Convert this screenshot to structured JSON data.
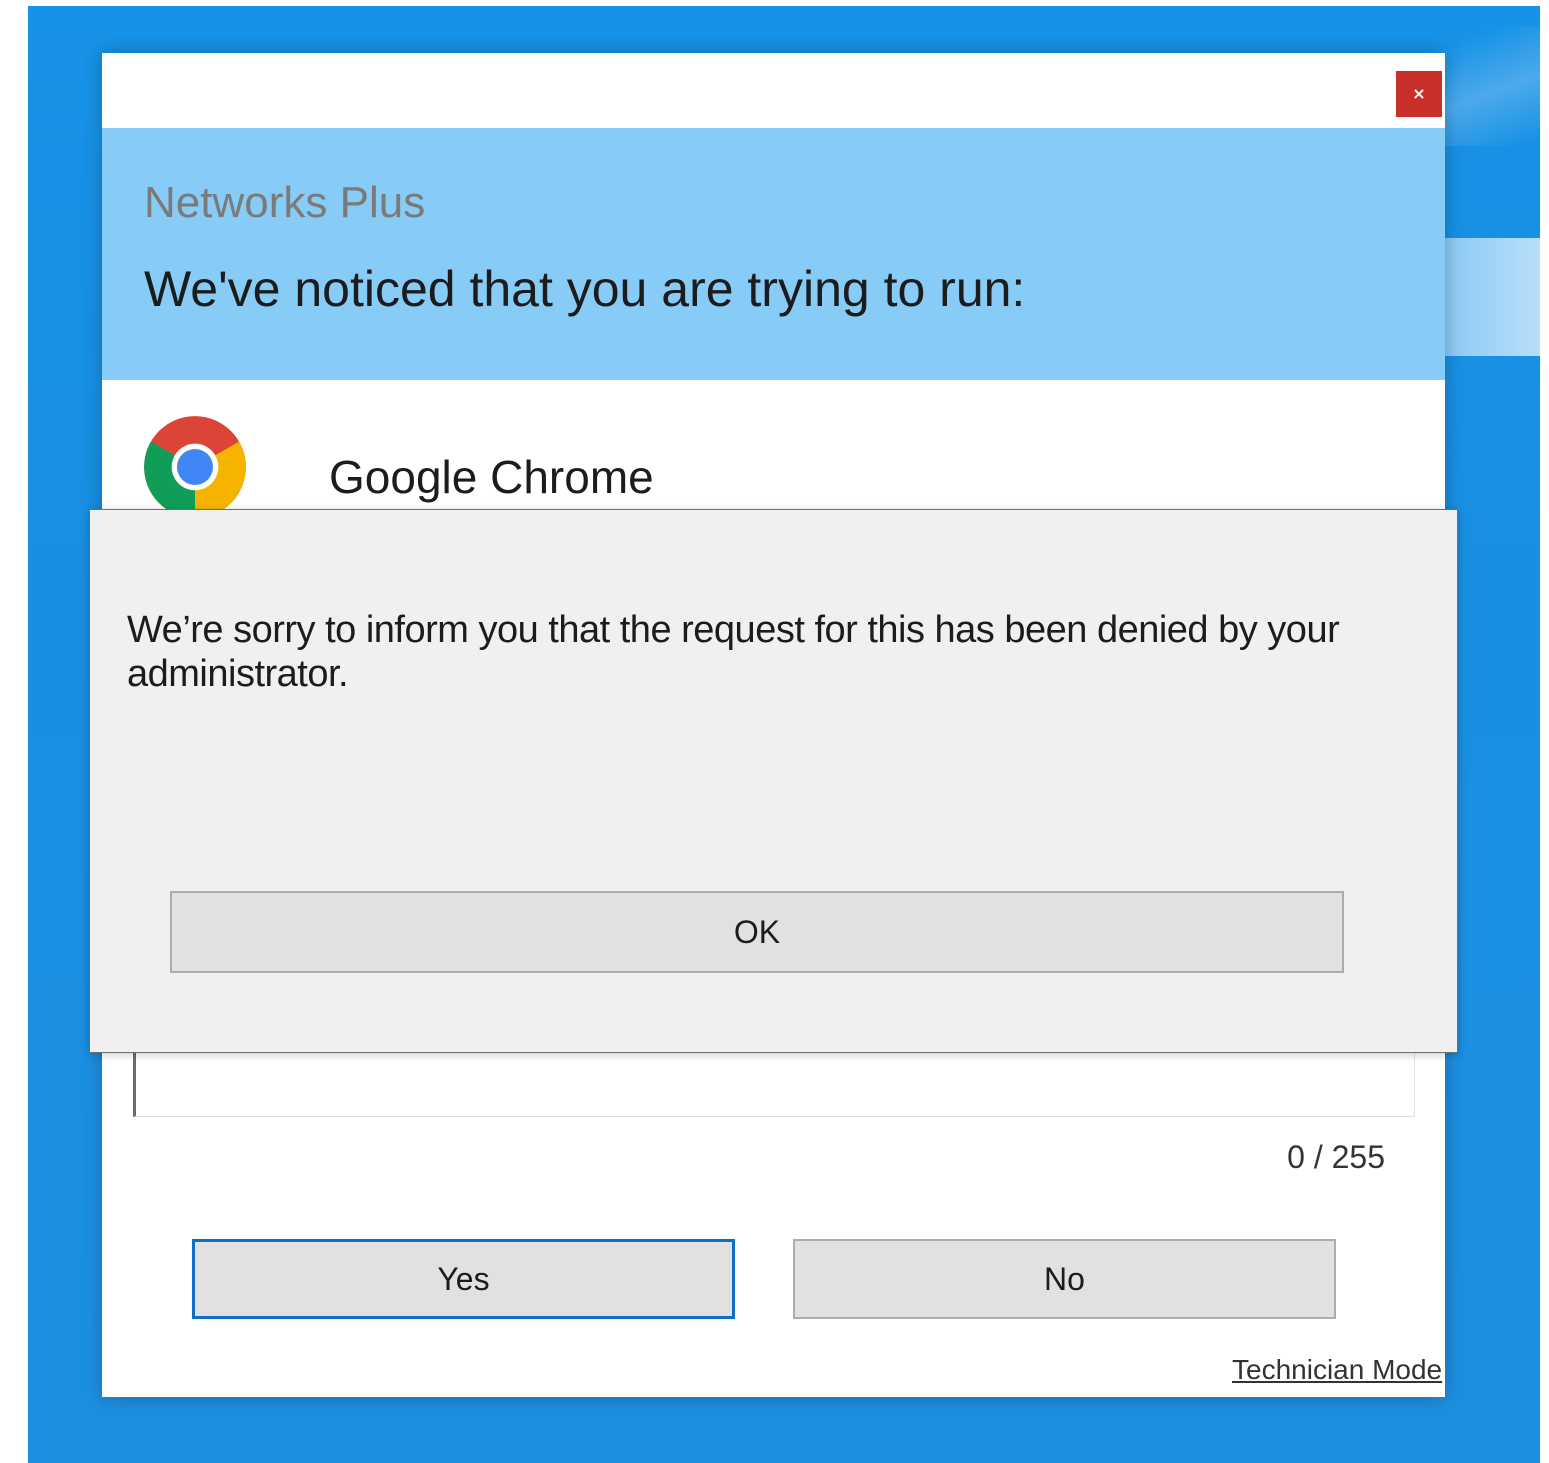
{
  "window": {
    "close_label": "×",
    "company_name": "Networks Plus",
    "heading": "We've noticed that you are trying to run:",
    "app_name": "Google Chrome",
    "app_icon": "google-chrome-icon",
    "char_counter": "0 / 255",
    "yes_label": "Yes",
    "no_label": "No",
    "technician_mode_label": "Technician Mode"
  },
  "dialog": {
    "message": "We’re sorry to inform you that the request for this has been denied by your administrator.",
    "ok_label": "OK"
  },
  "colors": {
    "header_band": "#86ccf6",
    "close_button": "#c9302c",
    "desktop": "#1a8fe2",
    "dialog_background": "#f0f0f0",
    "focused_button_border": "#0f6fc6"
  }
}
